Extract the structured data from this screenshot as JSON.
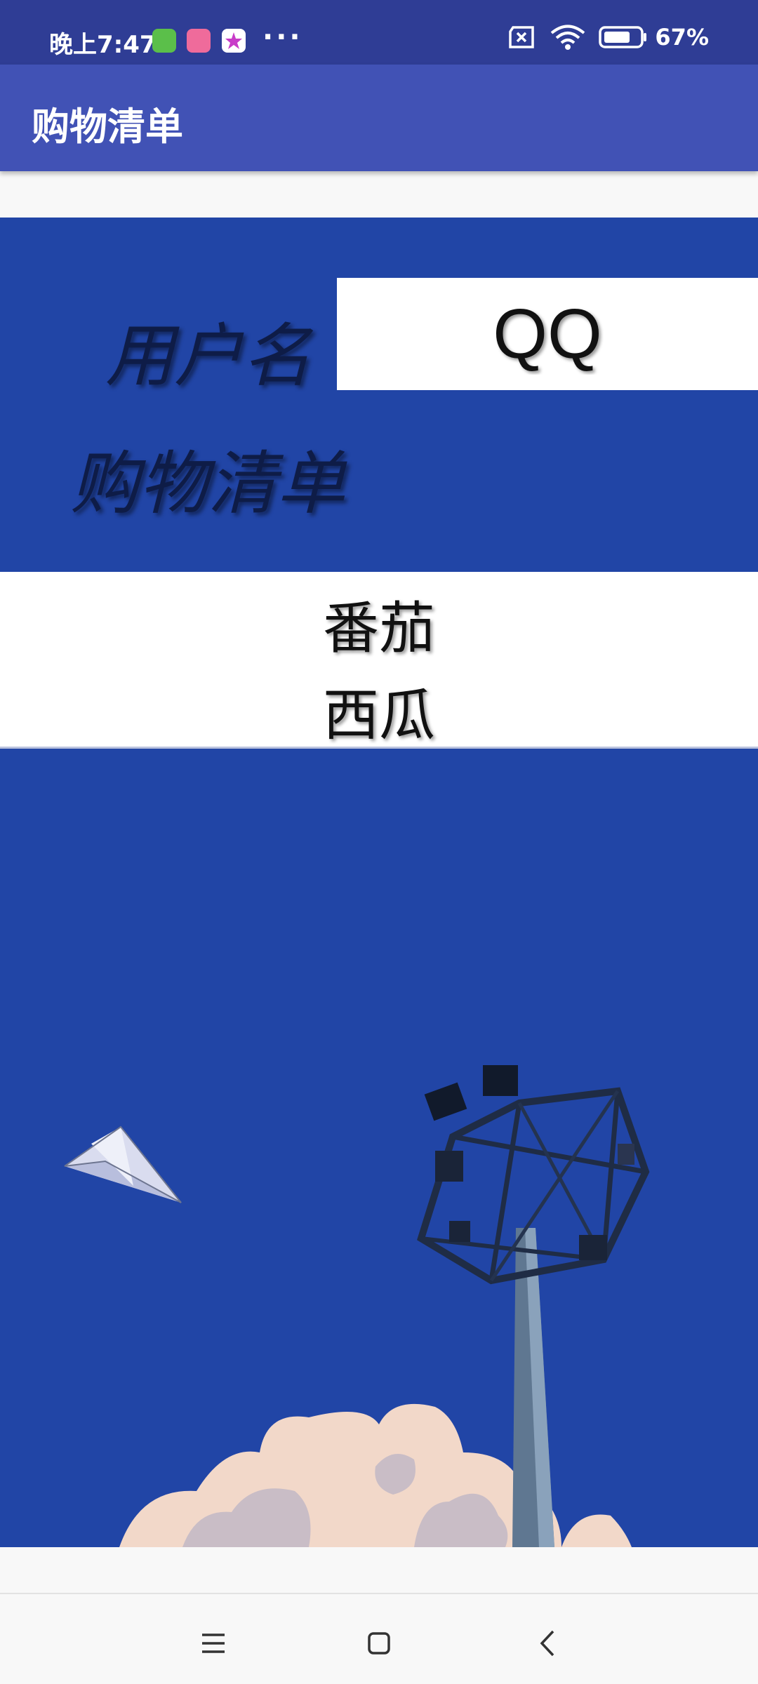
{
  "status_bar": {
    "time": "晚上7:47",
    "battery": "67%"
  },
  "app_bar": {
    "title": "购物清单"
  },
  "form": {
    "username_label": "用户名",
    "username_value": "QQ",
    "list_label": "购物清单"
  },
  "shopping_list": [
    {
      "name": "番茄"
    },
    {
      "name": "西瓜"
    }
  ],
  "colors": {
    "status_bar": "#2f3d95",
    "app_bar": "#4152b5",
    "background": "#2145a6"
  }
}
